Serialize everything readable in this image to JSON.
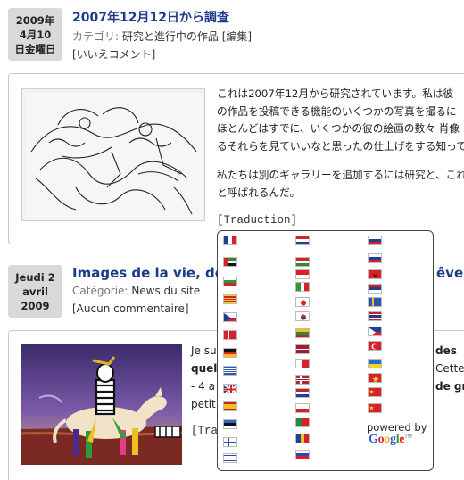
{
  "post1": {
    "date_line1": "2009年",
    "date_line2": "4月10",
    "date_line3": "日金曜日",
    "title": "2007年12月12日から調査",
    "category_label": "カテゴリ:",
    "category_value": "研究と進行中の作品",
    "edit_link": "[編集]",
    "comments": "[いいえコメント]",
    "body_lines": [
      "これは2007年12月から研究されています。私は彼",
      "の作品を投稿できる機能のいくつかの写真を撮るに",
      "ほとんどはすでに、いくつかの彼の絵画の数々 肖像",
      "るそれらを見ていいなと思ったの仕上げをする知って"
    ],
    "body_lines_2": [
      "私たちは別のギャラリーを追加するには研究と、これ",
      "と呼ばれるんだ。"
    ],
    "translate_link": "[Traduction]"
  },
  "post2": {
    "date_line1": "Jeudi 2",
    "date_line2": "avril",
    "date_line3": "2009",
    "title": "Images de la vie, de",
    "title_tail": "êve p",
    "category_label": "Catégorie:",
    "category_value": "News du site",
    "comments": "[Aucun commentaire]",
    "body_left": [
      "Je su",
      "quel",
      "- 4 a",
      "petit"
    ],
    "body_right": [
      "des",
      "Cette",
      "de gra",
      ""
    ],
    "translate_link_partial": "[Trad"
  },
  "translate_popup": {
    "powered_by": "powered by",
    "google": "Google",
    "tm": "TM"
  }
}
